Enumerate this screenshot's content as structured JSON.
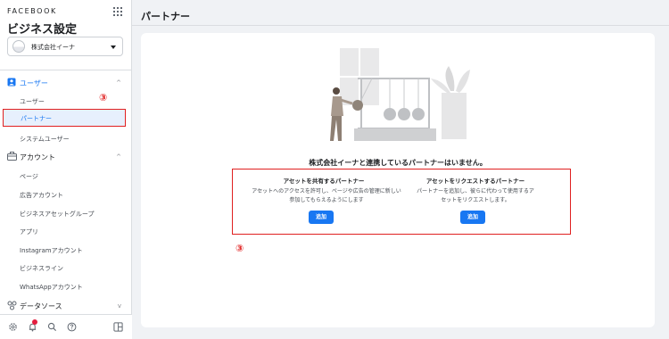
{
  "sidebar": {
    "brand": "FACEBOOK",
    "heading": "ビジネス設定",
    "account": "株式会社イーナ",
    "sections": {
      "users": {
        "label": "ユーザー",
        "chevron": "^"
      },
      "accounts": {
        "label": "アカウント",
        "chevron": "^"
      },
      "data_sources": {
        "label": "データソース",
        "chevron": "v"
      }
    },
    "user_items": [
      "ユーザー",
      "パートナー",
      "システムユーザー"
    ],
    "account_items": [
      "ページ",
      "広告アカウント",
      "ビジネスアセットグループ",
      "アプリ",
      "Instagramアカウント",
      "ビジネスライン",
      "WhatsAppアカウント"
    ],
    "bottom_icons": [
      "gear-icon",
      "bell-icon",
      "search-icon",
      "help-icon",
      "panel-icon"
    ]
  },
  "main": {
    "title": "パートナー",
    "empty_title": "株式会社イーナと連携しているパートナーはいません。",
    "share_partner": {
      "title": "アセットを共有するパートナー",
      "desc_line1": "アセットへのアクセスを許可し、ページや広告の管理に新しい",
      "desc_line2": "参加してもらえるようにします",
      "button": "追加"
    },
    "request_partner": {
      "title": "アセットをリクエストするパートナー",
      "desc_line1": "パートナーを追加し、彼らに代わって使用するア",
      "desc_line2": "セットをリクエストします。",
      "button": "追加"
    }
  },
  "annotations": {
    "step_top": "③",
    "step_bottom": "③"
  },
  "colors": {
    "accent": "#1877f2",
    "highlight": "#e02020"
  }
}
